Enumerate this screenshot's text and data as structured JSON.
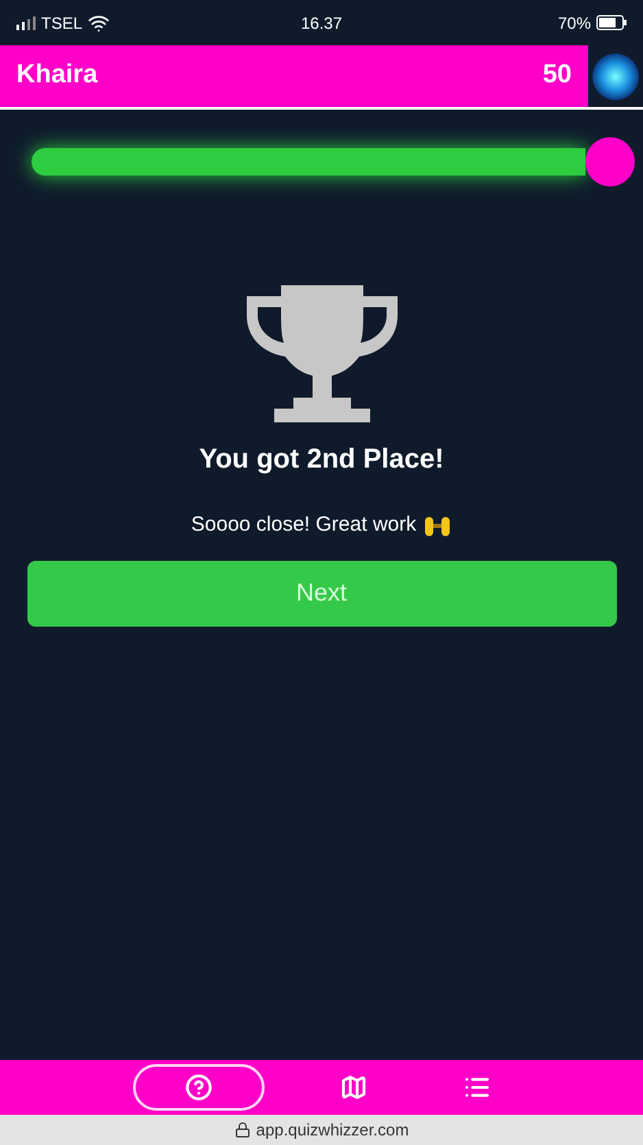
{
  "status_bar": {
    "carrier": "TSEL",
    "time": "16.37",
    "battery": "70%"
  },
  "header": {
    "player": "Khaira",
    "score": "50"
  },
  "progress": {
    "level": 1.0
  },
  "result": {
    "title": "You got 2nd Place!",
    "message": "Soooo close! Great work"
  },
  "next_button": {
    "label": "Next"
  },
  "nav": [
    {
      "kind": "help",
      "selected": true
    },
    {
      "kind": "map",
      "selected": false
    },
    {
      "kind": "list",
      "selected": false
    }
  ],
  "url_bar": {
    "address": "app.quizwhizzer.com"
  }
}
